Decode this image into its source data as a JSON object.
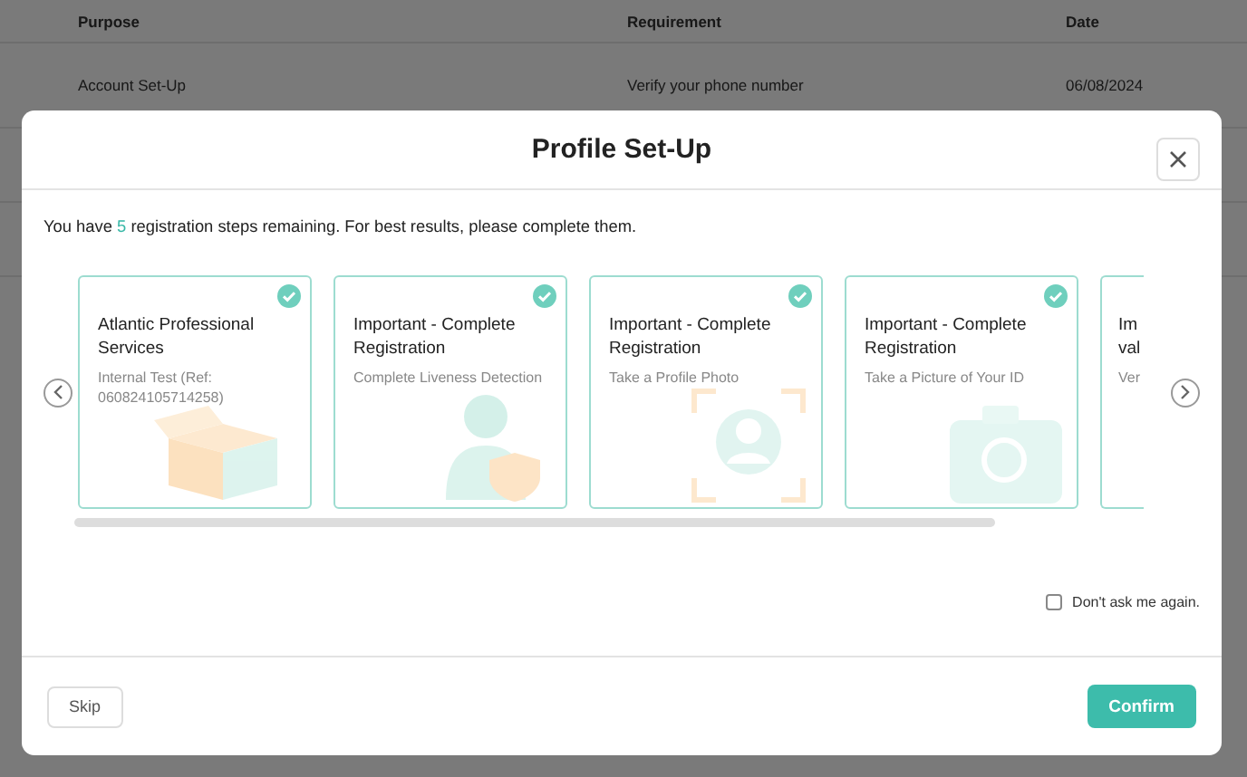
{
  "background_table": {
    "columns": [
      "Purpose",
      "Requirement",
      "Date"
    ],
    "rows": [
      [
        "Account Set-Up",
        "Verify your phone number",
        "06/08/2024"
      ]
    ]
  },
  "modal": {
    "title": "Profile Set-Up",
    "message": {
      "before": "You have ",
      "count": "5",
      "after": " registration steps remaining. For best results, please complete them."
    },
    "cards": [
      {
        "kind": "box",
        "title": "Atlantic Professional Services",
        "description": "Internal Test (Ref: 060824105714258)",
        "checked": true
      },
      {
        "kind": "person-shield",
        "title": "Important - Complete Registration",
        "description": "Complete Liveness Detection",
        "checked": true
      },
      {
        "kind": "profile-frame",
        "title": "Important - Complete Registration",
        "description": "Take a Profile Photo",
        "checked": true
      },
      {
        "kind": "camera",
        "title": "Important - Complete Registration",
        "description": "Take a Picture of Your ID",
        "checked": true
      },
      {
        "kind": "partial",
        "title": "Im val",
        "description": "Ver",
        "checked": false
      }
    ],
    "dont_ask": {
      "label": "Don't ask me again.",
      "checked": false
    },
    "buttons": {
      "skip": "Skip",
      "confirm": "Confirm"
    }
  }
}
